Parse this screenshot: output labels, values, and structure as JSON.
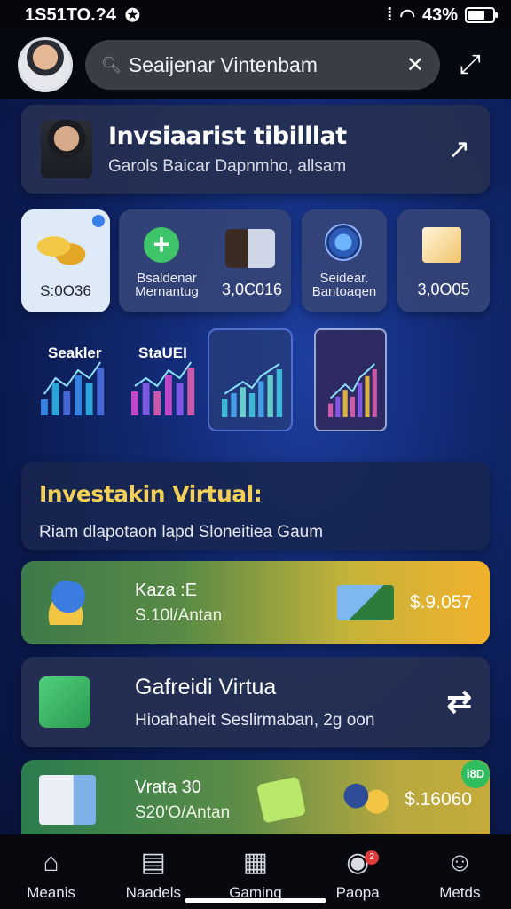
{
  "status": {
    "time": "1S51TO.?4",
    "battery_text": "43%",
    "battery_level": 0.7
  },
  "header": {
    "search_text": "Seaijenar Vintenbam",
    "search_icon": "search-icon",
    "tools_icon": "tools-icon",
    "share_icon": "share-icon"
  },
  "profile": {
    "title": "Invsiaarist tibilllat",
    "subtitle": "Garols Baicar Dapnmho, allsam",
    "share_icon": "share-icon"
  },
  "tiles": [
    {
      "value": "S:0O36"
    },
    {
      "label": "Bsaldenar Mernantug",
      "value": "3,0C016"
    },
    {
      "label": "Seidear. Bantoaqen"
    },
    {
      "value": "3,0O05"
    }
  ],
  "charts": [
    {
      "title": "Seakler"
    },
    {
      "title": "StaUEI"
    }
  ],
  "chart_data": [
    {
      "type": "bar",
      "title": "Seakler",
      "values": [
        2,
        4,
        3,
        5,
        4,
        6
      ]
    },
    {
      "type": "bar",
      "title": "StaUEI",
      "values": [
        3,
        4,
        3,
        5,
        4,
        6
      ]
    },
    {
      "type": "bar",
      "title": "",
      "values": [
        3,
        4,
        5,
        4,
        6,
        7,
        8
      ]
    },
    {
      "type": "bar",
      "title": "",
      "values": [
        2,
        3,
        4,
        3,
        5,
        6,
        7
      ]
    }
  ],
  "invest": {
    "title": "Investakin Virtual:",
    "subtitle": "Riam dlapotaon lapd Sloneitiea Gaum"
  },
  "wallet": {
    "line1": "Kaza :E",
    "line2": "S.10l/Antan",
    "amount": "$.9.057"
  },
  "game": {
    "title": "Gafreidi Virtua",
    "subtitle": "Hioahaheit Seslirmaban, 2g oon",
    "action_icon": "shuffle-icon"
  },
  "bottom_card": {
    "line1": "Vrata 30",
    "line2": "S20'O/Antan",
    "amount": "$.16060",
    "badge": "i8D"
  },
  "nav": [
    {
      "label": "Meanis",
      "icon": "home-icon"
    },
    {
      "label": "Naadels",
      "icon": "grid-icon"
    },
    {
      "label": "Gaming",
      "icon": "game-icon"
    },
    {
      "label": "Paopa",
      "icon": "chat-icon",
      "badge": "2"
    },
    {
      "label": "Metds",
      "icon": "profile-icon"
    }
  ]
}
